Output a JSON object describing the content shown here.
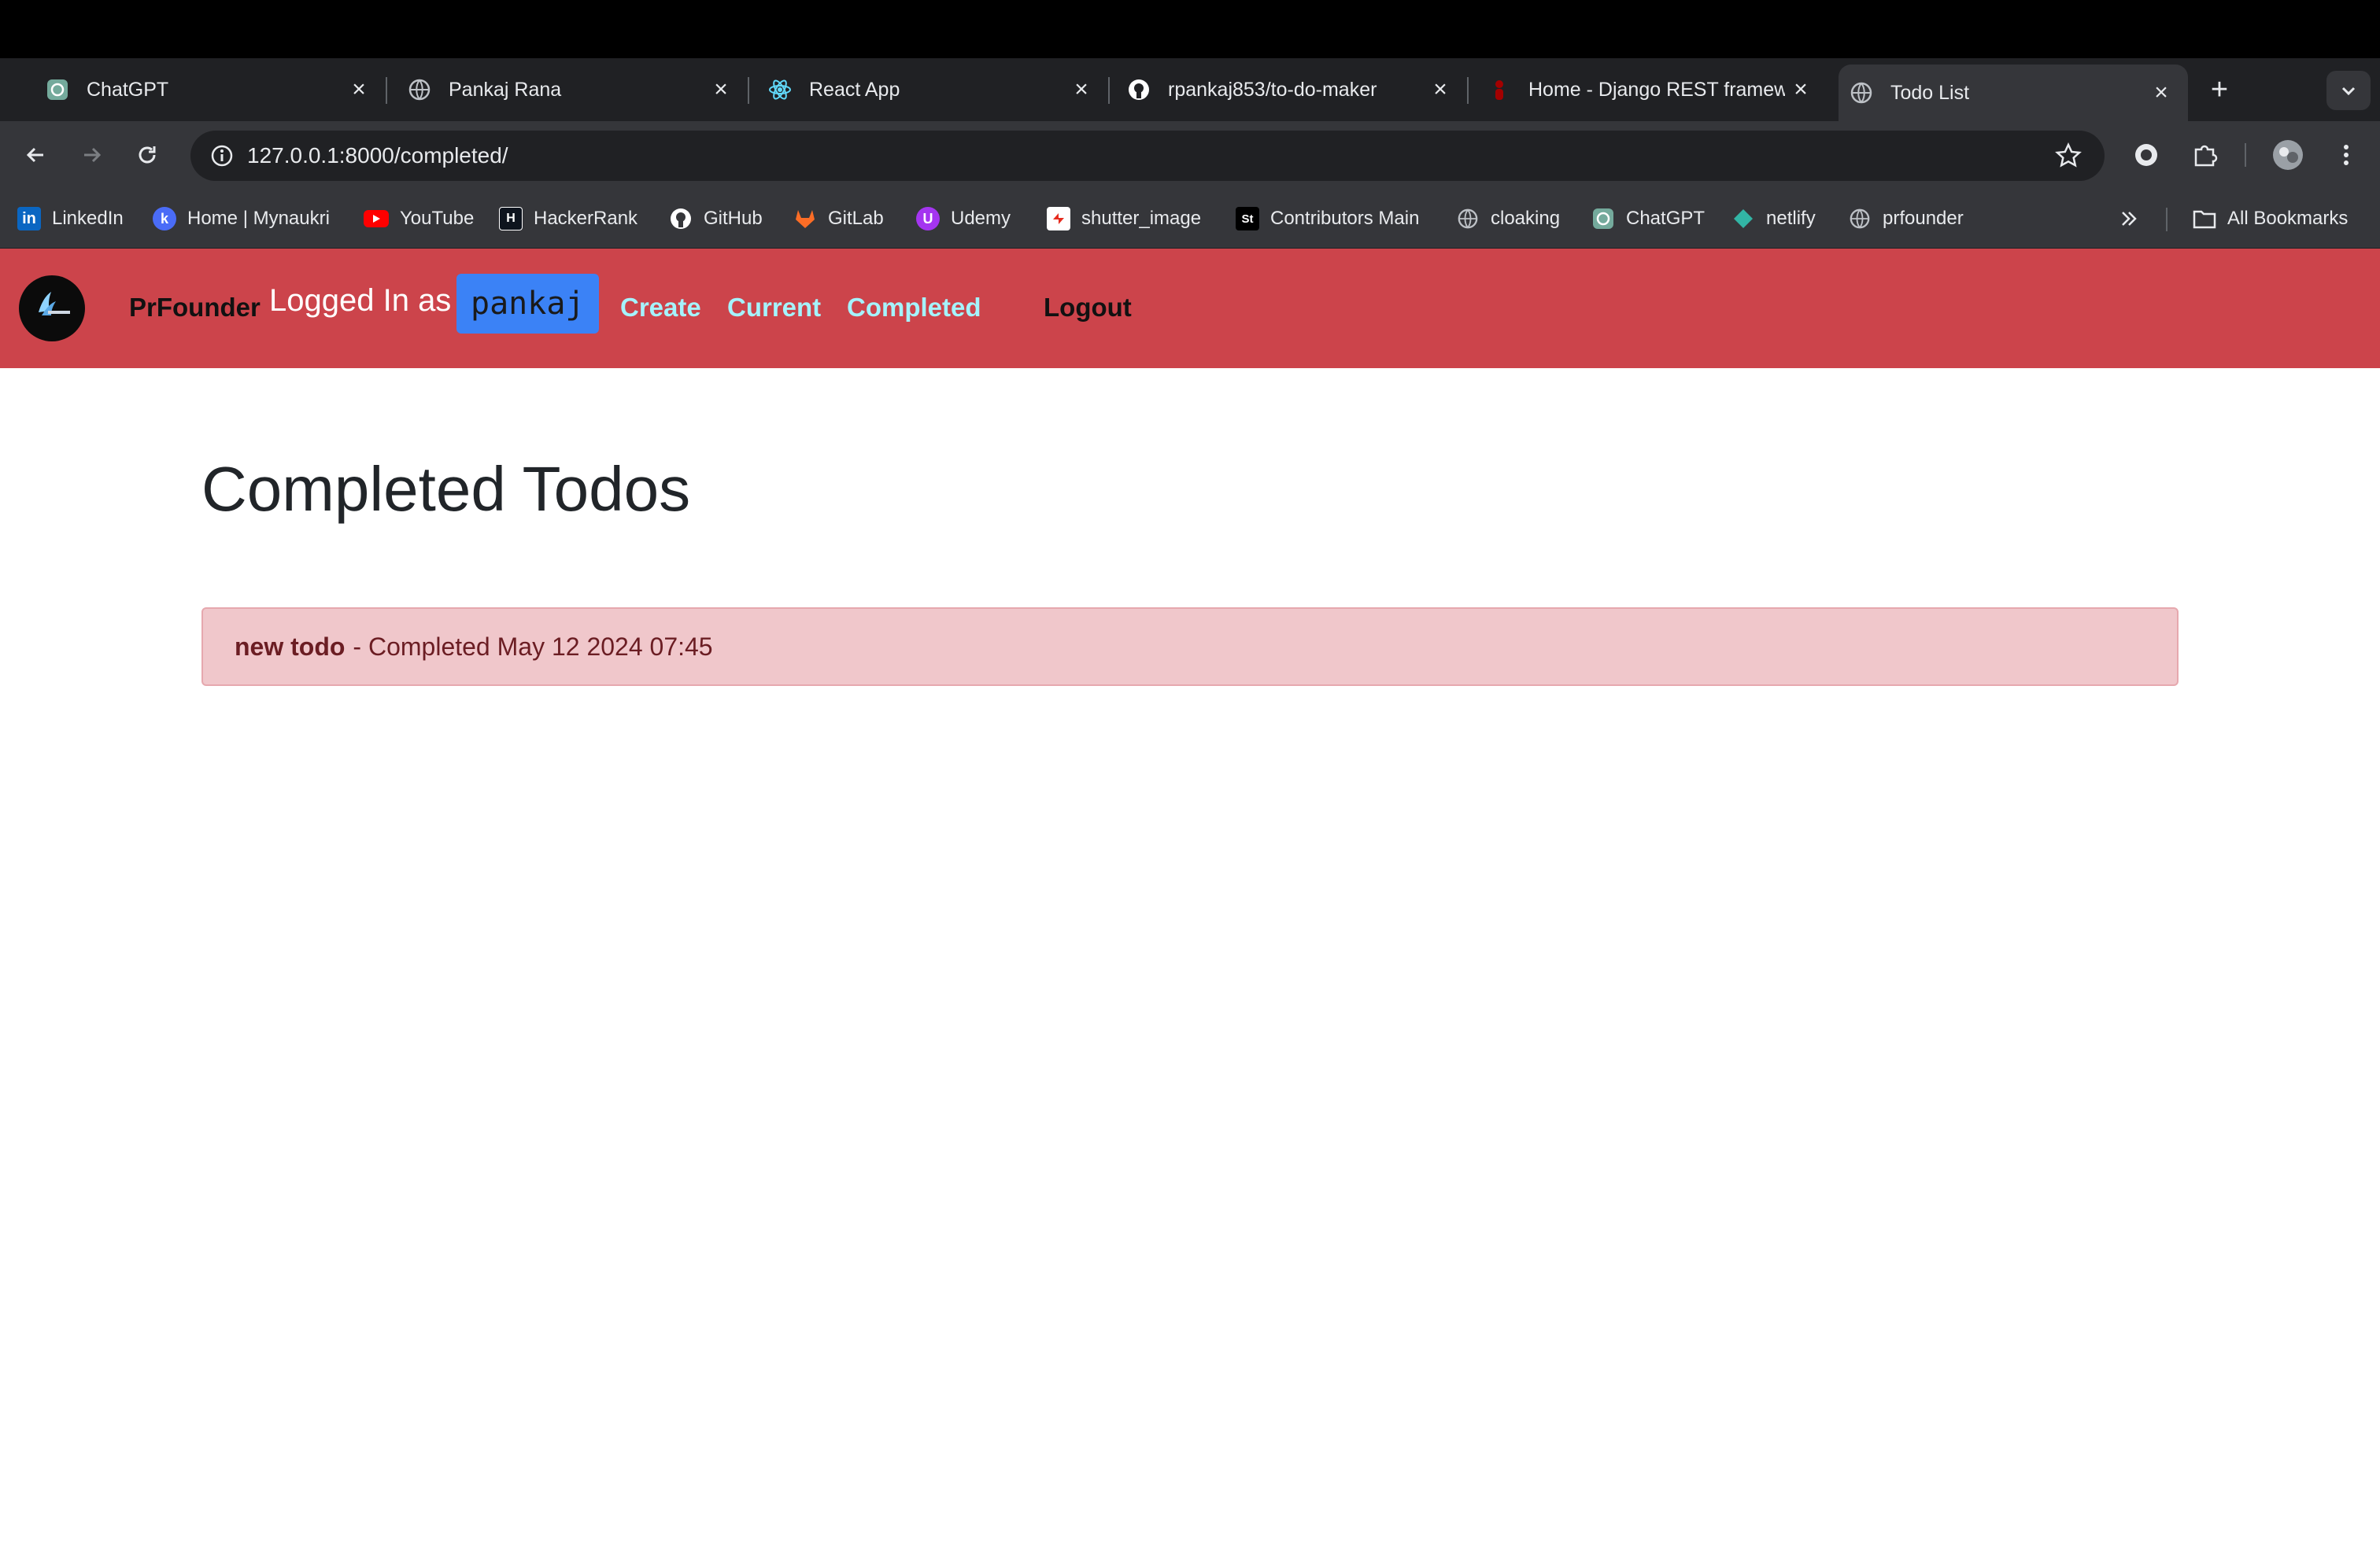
{
  "browser": {
    "tabs": [
      {
        "label": "ChatGPT",
        "icon": "chatgpt-icon"
      },
      {
        "label": "Pankaj Rana",
        "icon": "globe-icon"
      },
      {
        "label": "React App",
        "icon": "react-icon"
      },
      {
        "label": "rpankaj853/to-do-maker",
        "icon": "github-icon"
      },
      {
        "label": "Home - Django REST framew",
        "icon": "django-icon"
      },
      {
        "label": "Todo List",
        "icon": "globe-icon",
        "active": true
      }
    ],
    "url": "127.0.0.1:8000/completed/",
    "bookmarks": [
      {
        "label": "LinkedIn",
        "icon": "linkedin-icon"
      },
      {
        "label": "Home | Mynaukri",
        "icon": "mynaukri-icon"
      },
      {
        "label": "YouTube",
        "icon": "youtube-icon"
      },
      {
        "label": "HackerRank",
        "icon": "hackerrank-icon"
      },
      {
        "label": "GitHub",
        "icon": "github-icon"
      },
      {
        "label": "GitLab",
        "icon": "gitlab-icon"
      },
      {
        "label": "Udemy",
        "icon": "udemy-icon"
      },
      {
        "label": "shutter_image",
        "icon": "shutter-icon"
      },
      {
        "label": "Contributors Main",
        "icon": "st-icon"
      },
      {
        "label": "cloaking",
        "icon": "globe-icon"
      },
      {
        "label": "ChatGPT",
        "icon": "chatgpt-icon"
      },
      {
        "label": "netlify",
        "icon": "netlify-icon"
      },
      {
        "label": "prfounder",
        "icon": "globe-icon"
      }
    ],
    "all_bookmarks_label": "All Bookmarks"
  },
  "app": {
    "brand": "PrFounder",
    "logged_in_text": "Logged In as",
    "username": "pankaj",
    "nav": {
      "create": "Create",
      "current": "Current",
      "completed": "Completed",
      "logout": "Logout"
    },
    "colors": {
      "navbar": "#cc444b",
      "nav_link": "#a5f3fc",
      "user_badge": "#3b82f6",
      "todo_bg": "#f0c7cb"
    }
  },
  "page": {
    "title": "Completed Todos",
    "todos": [
      {
        "name": "new todo",
        "completed_text": "- Completed May 12 2024 07:45"
      }
    ]
  }
}
